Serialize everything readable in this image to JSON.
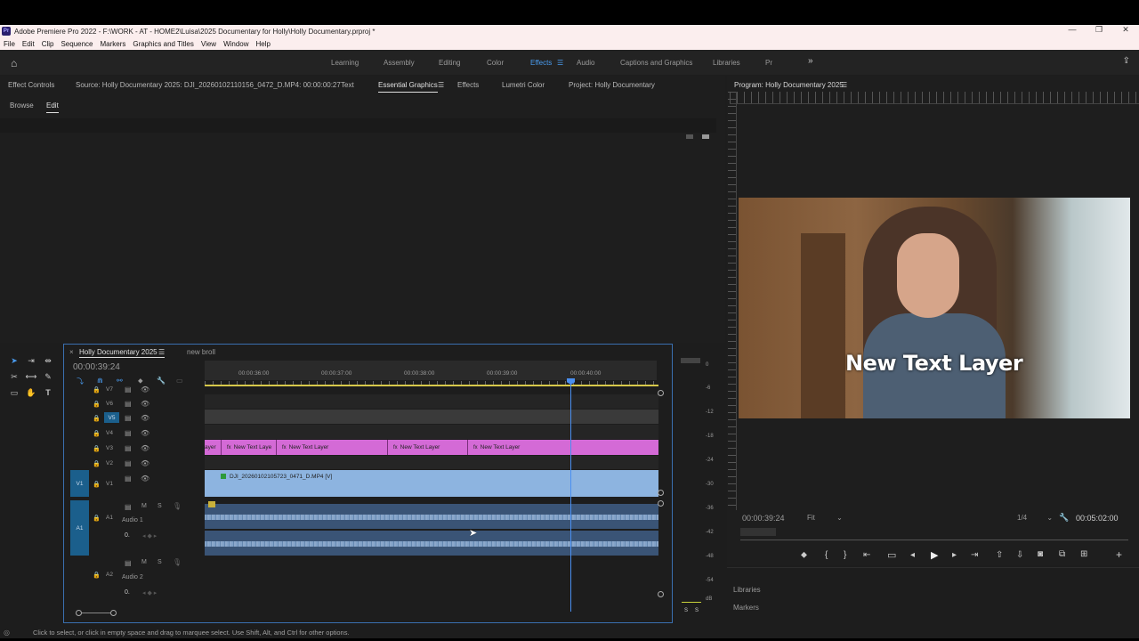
{
  "window": {
    "title": "Adobe Premiere Pro 2022 - F:\\WORK - AT - HOME2\\Luisa\\2025 Documentary for Holly\\Holly Documentary.prproj *",
    "app_icon": "Pr"
  },
  "menu": [
    "File",
    "Edit",
    "Clip",
    "Sequence",
    "Markers",
    "Graphics and Titles",
    "View",
    "Window",
    "Help"
  ],
  "workspaces": {
    "items": [
      "Learning",
      "Assembly",
      "Editing",
      "Color",
      "Effects",
      "Audio",
      "Captions and Graphics",
      "Libraries",
      "Pr"
    ],
    "active": "Effects"
  },
  "source_panel": {
    "tabs": [
      "Effect Controls",
      "Source: Holly Documentary 2025: DJI_20260102110156_0472_D.MP4: 00:00:00:27",
      "Text",
      "Essential Graphics",
      "Effects",
      "Lumetri Color",
      "Project: Holly Documentary"
    ],
    "active_tab": "Essential Graphics",
    "subtabs": [
      "Browse",
      "Edit"
    ],
    "active_subtab": "Edit"
  },
  "program_monitor": {
    "title": "Program: Holly Documentary 2025",
    "overlay_text": "New Text Layer",
    "timecode": "00:00:39:24",
    "zoom": "Fit",
    "resolution": "1/4",
    "duration": "00:05:02:00"
  },
  "lower_right_panels": [
    "Libraries",
    "Markers"
  ],
  "timeline": {
    "tabs": [
      "Holly Documentary 2025",
      "new broll"
    ],
    "timecode": "00:00:39:24",
    "ruler_labels": [
      "00:00:36:00",
      "00:00:37:00",
      "00:00:38:00",
      "00:00:39:00",
      "00:00:40:00"
    ],
    "video_tracks": [
      "V7",
      "V6",
      "V5",
      "V4",
      "V3",
      "V2",
      "V1"
    ],
    "source_v1": "V1",
    "source_a1": "A1",
    "audio_tracks": [
      {
        "id": "A1",
        "name": "Audio 1",
        "m": "M",
        "s": "S",
        "vol": "0."
      },
      {
        "id": "A2",
        "name": "Audio 2",
        "m": "M",
        "s": "S",
        "vol": "0."
      }
    ],
    "text_clips": [
      "ayer",
      "New Text Laye",
      "New Text Layer",
      "New Text Layer",
      "New Text Layer"
    ],
    "video_clip": "DJI_20260102105723_0471_D.MP4 [V]"
  },
  "audio_meter": {
    "labels": [
      "0",
      "-6",
      "-12",
      "-18",
      "-24",
      "-30",
      "-36",
      "-42",
      "-48",
      "-54",
      "dB"
    ],
    "solo": [
      "S",
      "S"
    ]
  },
  "status_bar": "Click to select, or click in empty space and drag to marquee select. Use Shift, Alt, and Ctrl for other options."
}
